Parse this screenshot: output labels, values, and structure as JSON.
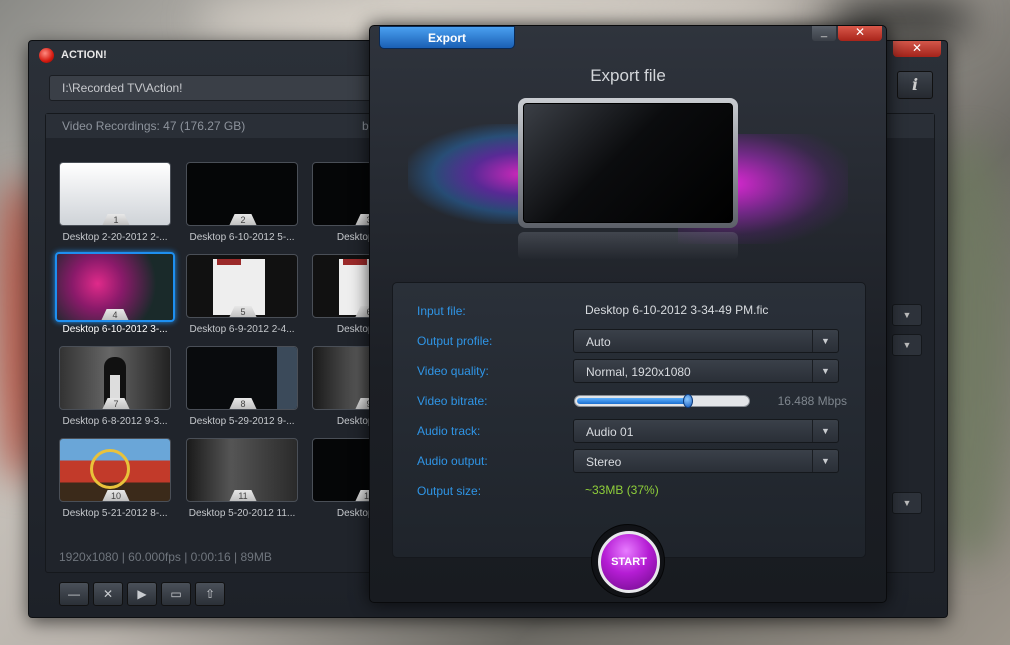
{
  "app": {
    "title": "ACTION!",
    "close_glyph": "✕",
    "path": "I:\\Recorded TV\\Action!",
    "info_glyph": "i",
    "recordings_header": "Video Recordings: 47 (176.27 GB)",
    "header_fragment": "b",
    "status_line": "1920x1080 | 60.000fps | 0:00:16 | 89MB",
    "thumbnails": [
      {
        "num": "1",
        "caption": "Desktop 2-20-2012 2-..."
      },
      {
        "num": "2",
        "caption": "Desktop 6-10-2012 5-..."
      },
      {
        "num": "3",
        "caption": "Desktop 6-1..."
      },
      {
        "num": "4",
        "caption": "Desktop 6-10-2012 3-..."
      },
      {
        "num": "5",
        "caption": "Desktop 6-9-2012 2-4..."
      },
      {
        "num": "6",
        "caption": "Desktop 6-9..."
      },
      {
        "num": "7",
        "caption": "Desktop 6-8-2012 9-3..."
      },
      {
        "num": "8",
        "caption": "Desktop 5-29-2012 9-..."
      },
      {
        "num": "9",
        "caption": "Desktop 5-2..."
      },
      {
        "num": "10",
        "caption": "Desktop 5-21-2012 8-..."
      },
      {
        "num": "11",
        "caption": "Desktop 5-20-2012 11..."
      },
      {
        "num": "12",
        "caption": "Desktop 4-2..."
      }
    ],
    "toolbar": {
      "minus": "—",
      "delete": "✕",
      "play": "▶",
      "folder": "▭",
      "upload": "⇧"
    }
  },
  "export": {
    "tab_label": "Export",
    "min_glyph": "_",
    "close_glyph": "✕",
    "title": "Export file",
    "labels": {
      "input_file": "Input file:",
      "output_profile": "Output profile:",
      "video_quality": "Video quality:",
      "video_bitrate": "Video bitrate:",
      "audio_track": "Audio track:",
      "audio_output": "Audio output:",
      "output_size": "Output size:"
    },
    "values": {
      "input_file": "Desktop 6-10-2012 3-34-49 PM.fic",
      "output_profile": "Auto",
      "video_quality": "Normal, 1920x1080",
      "video_bitrate": "16.488 Mbps",
      "audio_track": "Audio 01",
      "audio_output": "Stereo",
      "output_size": "~33MB (37%)"
    },
    "bitrate_slider_fraction": 0.66,
    "start_label": "START",
    "dropdown_glyph": "▼"
  },
  "colors": {
    "accent_blue": "#2f95e6",
    "start_purple": "#b51dd4",
    "size_green": "#8fcf3a"
  }
}
